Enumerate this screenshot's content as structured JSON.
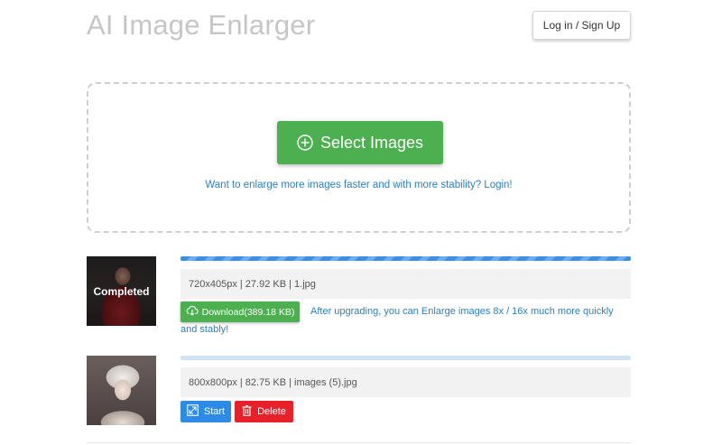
{
  "header": {
    "title": "AI Image Enlarger",
    "login_label": "Log in / Sign Up"
  },
  "dropzone": {
    "select_label": "Select Images",
    "upsell_text": "Want to enlarge more images faster and with more stability? Login!"
  },
  "files": [
    {
      "status_overlay": "Completed",
      "progress": 1.0,
      "info": "720x405px | 27.92 KB | 1.jpg",
      "download_label": "Download(389.18 KB)",
      "upgrade_note": "After upgrading, you can Enlarge images 8x / 16x much more quickly and stably!"
    },
    {
      "progress": 0.0,
      "info": "800x800px | 82.75 KB | images (5).jpg",
      "start_label": "Start",
      "delete_label": "Delete"
    }
  ],
  "colors": {
    "primary_green": "#4caf50",
    "link_blue": "#2b7fc4",
    "start_blue": "#2d8ae6",
    "delete_red": "#e8202a"
  },
  "icons": {
    "select": "plus-circle-icon",
    "download": "cloud-download-icon",
    "start": "expand-icon",
    "delete": "trash-icon"
  }
}
